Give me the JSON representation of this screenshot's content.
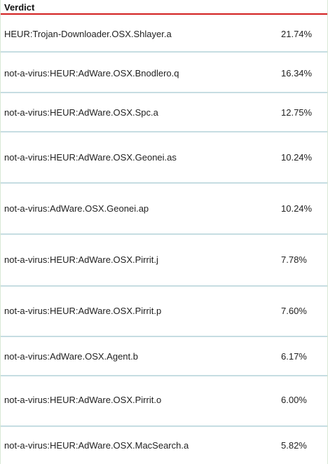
{
  "table": {
    "header": "Verdict",
    "rows": [
      {
        "verdict": "HEUR:Trojan-Downloader.OSX.Shlayer.a",
        "percent": "21.74%"
      },
      {
        "verdict": "not-a-virus:HEUR:AdWare.OSX.Bnodlero.q",
        "percent": "16.34%"
      },
      {
        "verdict": "not-a-virus:HEUR:AdWare.OSX.Spc.a",
        "percent": "12.75%"
      },
      {
        "verdict": "not-a-virus:HEUR:AdWare.OSX.Geonei.as",
        "percent": "10.24%"
      },
      {
        "verdict": "not-a-virus:AdWare.OSX.Geonei.ap",
        "percent": "10.24%"
      },
      {
        "verdict": "not-a-virus:HEUR:AdWare.OSX.Pirrit.j",
        "percent": "7.78%"
      },
      {
        "verdict": "not-a-virus:HEUR:AdWare.OSX.Pirrit.p",
        "percent": "7.60%"
      },
      {
        "verdict": "not-a-virus:AdWare.OSX.Agent.b",
        "percent": "6.17%"
      },
      {
        "verdict": "not-a-virus:HEUR:AdWare.OSX.Pirrit.o",
        "percent": "6.00%"
      },
      {
        "verdict": "not-a-virus:HEUR:AdWare.OSX.MacSearch.a",
        "percent": "5.82%"
      }
    ]
  }
}
